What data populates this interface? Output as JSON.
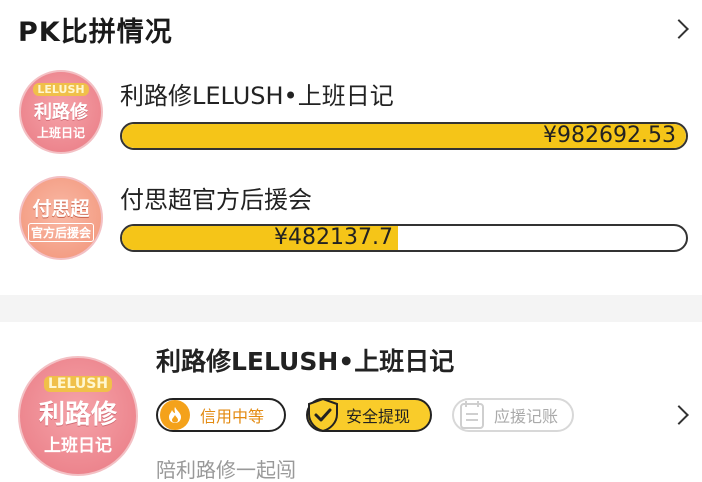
{
  "pk_section": {
    "title": "PK比拼情况",
    "contestants": [
      {
        "name": "利路修LELUSH•上班日记",
        "amount": "¥982692.53",
        "fill_ratio": 1.0,
        "avatar": {
          "tag": "LELUSH",
          "big": "利路修",
          "sub": "上班日记"
        }
      },
      {
        "name": "付思超官方后援会",
        "amount": "¥482137.7",
        "fill_ratio": 0.49,
        "avatar": {
          "big": "付思超",
          "sub": "官方后援会"
        }
      }
    ]
  },
  "group_card": {
    "name": "利路修LELUSH•上班日记",
    "avatar": {
      "tag": "LELUSH",
      "big": "利路修",
      "sub": "上班日记"
    },
    "badges": {
      "credit": "信用中等",
      "safe": "安全提现",
      "account": "应援记账"
    },
    "description": "陪利路修一起闯"
  },
  "colors": {
    "bar_fill": "#f5c518",
    "credit_accent": "#f4a21b",
    "safe_bg": "#f9cc2a"
  },
  "icons": {
    "header_chevron": "chevron-right-icon",
    "card_chevron": "chevron-right-icon",
    "credit": "flame-icon",
    "safe": "shield-check-icon",
    "account": "notebook-icon"
  }
}
